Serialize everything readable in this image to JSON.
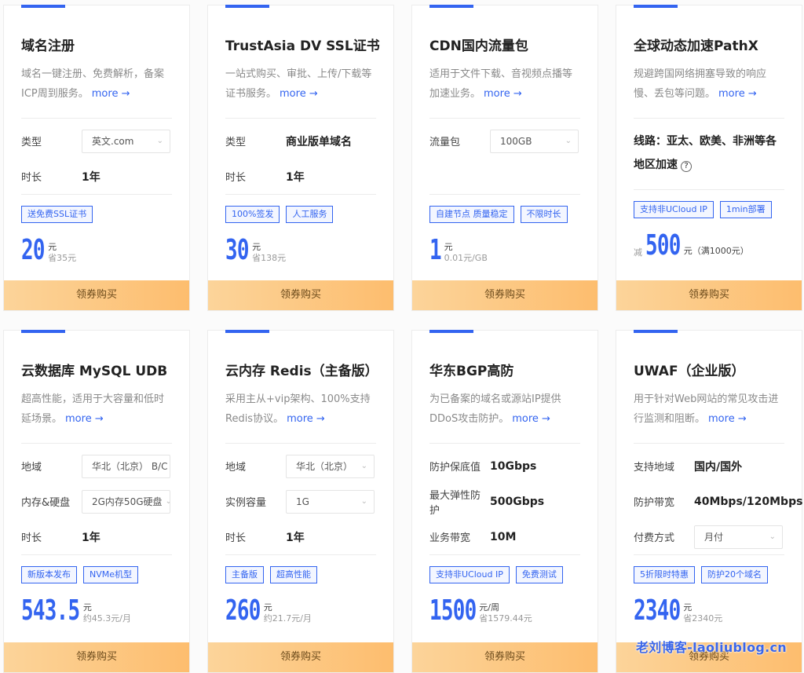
{
  "cards": [
    {
      "title": "域名注册",
      "desc": "域名一键注册、免费解析，备案ICP周到服务。",
      "more": "more →",
      "specs": [
        {
          "label": "类型",
          "select": "英文.com"
        },
        {
          "label": "时长",
          "value": "1年"
        }
      ],
      "tags": [
        "送免费SSL证书"
      ],
      "price": {
        "prefix": "",
        "number": "20",
        "unit": "元",
        "save": "省35元"
      },
      "buy": "领券购买"
    },
    {
      "title": "TrustAsia DV SSL证书",
      "desc": "一站式购买、审批、上传/下载等证书服务。",
      "more": "more →",
      "specs": [
        {
          "label": "类型",
          "value": "商业版单域名"
        },
        {
          "label": "时长",
          "value": "1年"
        }
      ],
      "tags": [
        "100%签发",
        "人工服务"
      ],
      "price": {
        "prefix": "",
        "number": "30",
        "unit": "元",
        "save": "省138元"
      },
      "buy": "领券购买"
    },
    {
      "title": "CDN国内流量包",
      "desc": "适用于文件下载、音视频点播等加速业务。",
      "more": "more →",
      "specs": [
        {
          "label": "流量包",
          "select": "100GB"
        }
      ],
      "tags": [
        "自建节点 质量稳定",
        "不限时长"
      ],
      "price": {
        "prefix": "",
        "number": "1",
        "unit": "元",
        "save": "0.01元/GB"
      },
      "buy": "领券购买"
    },
    {
      "title": "全球动态加速PathX",
      "desc": "规避跨国网络拥塞导致的响应慢、丢包等问题。",
      "more": "more →",
      "line_note": "线路：亚太、欧美、非洲等各地区加速",
      "help": "?",
      "tags": [
        "支持非UCloud IP",
        "1min部署"
      ],
      "price": {
        "prefix": "减",
        "number": "500",
        "unit_inline": "元（满1000元）"
      },
      "buy": "领券购买"
    },
    {
      "title": "云数据库 MySQL UDB",
      "desc": "超高性能，适用于大容量和低时延场景。",
      "more": "more →",
      "specs": [
        {
          "label": "地域",
          "select": "华北（北京） B/C"
        },
        {
          "label": "内存&硬盘",
          "select": "2G内存50G硬盘"
        },
        {
          "label": "时长",
          "value": "1年"
        }
      ],
      "tags": [
        "新版本发布",
        "NVMe机型"
      ],
      "price": {
        "prefix": "",
        "number": "543.5",
        "unit": "元",
        "save": "约45.3元/月"
      },
      "buy": "领券购买"
    },
    {
      "title": "云内存 Redis（主备版）",
      "desc": "采用主从+vip架构、100%支持Redis协议。",
      "more": "more →",
      "specs": [
        {
          "label": "地域",
          "select": "华北（北京）"
        },
        {
          "label": "实例容量",
          "select": "1G"
        },
        {
          "label": "时长",
          "value": "1年"
        }
      ],
      "tags": [
        "主备版",
        "超高性能"
      ],
      "price": {
        "prefix": "",
        "number": "260",
        "unit": "元",
        "save": "约21.7元/月"
      },
      "buy": "领券购买"
    },
    {
      "title": "华东BGP高防",
      "desc": "为已备案的域名或源站IP提供DDoS攻击防护。",
      "more": "more →",
      "specs": [
        {
          "label": "防护保底值",
          "value": "10Gbps"
        },
        {
          "label": "最大弹性防护",
          "value": "500Gbps"
        },
        {
          "label": "业务带宽",
          "value": "10M"
        }
      ],
      "tags": [
        "支持非UCloud IP",
        "免费测试"
      ],
      "price": {
        "prefix": "",
        "number": "1500",
        "unit": "元/周",
        "save": "省1579.44元"
      },
      "buy": "领券购买"
    },
    {
      "title": "UWAF（企业版）",
      "desc": "用于针对Web网站的常见攻击进行监测和阻断。",
      "more": "more →",
      "specs": [
        {
          "label": "支持地域",
          "value": "国内/国外"
        },
        {
          "label": "防护带宽",
          "value": "40Mbps/120Mbps"
        },
        {
          "label": "付费方式",
          "select": "月付"
        }
      ],
      "tags": [
        "5折限时特惠",
        "防护20个域名"
      ],
      "price": {
        "prefix": "",
        "number": "2340",
        "unit": "元",
        "save": "省2340元"
      },
      "buy": "领券购买"
    }
  ],
  "watermark": "老刘博客-laoliublog.cn",
  "colors": {
    "accent": "#3364f0",
    "buy_gradient_start": "#fcd49a",
    "buy_gradient_end": "#fdbd6e"
  }
}
